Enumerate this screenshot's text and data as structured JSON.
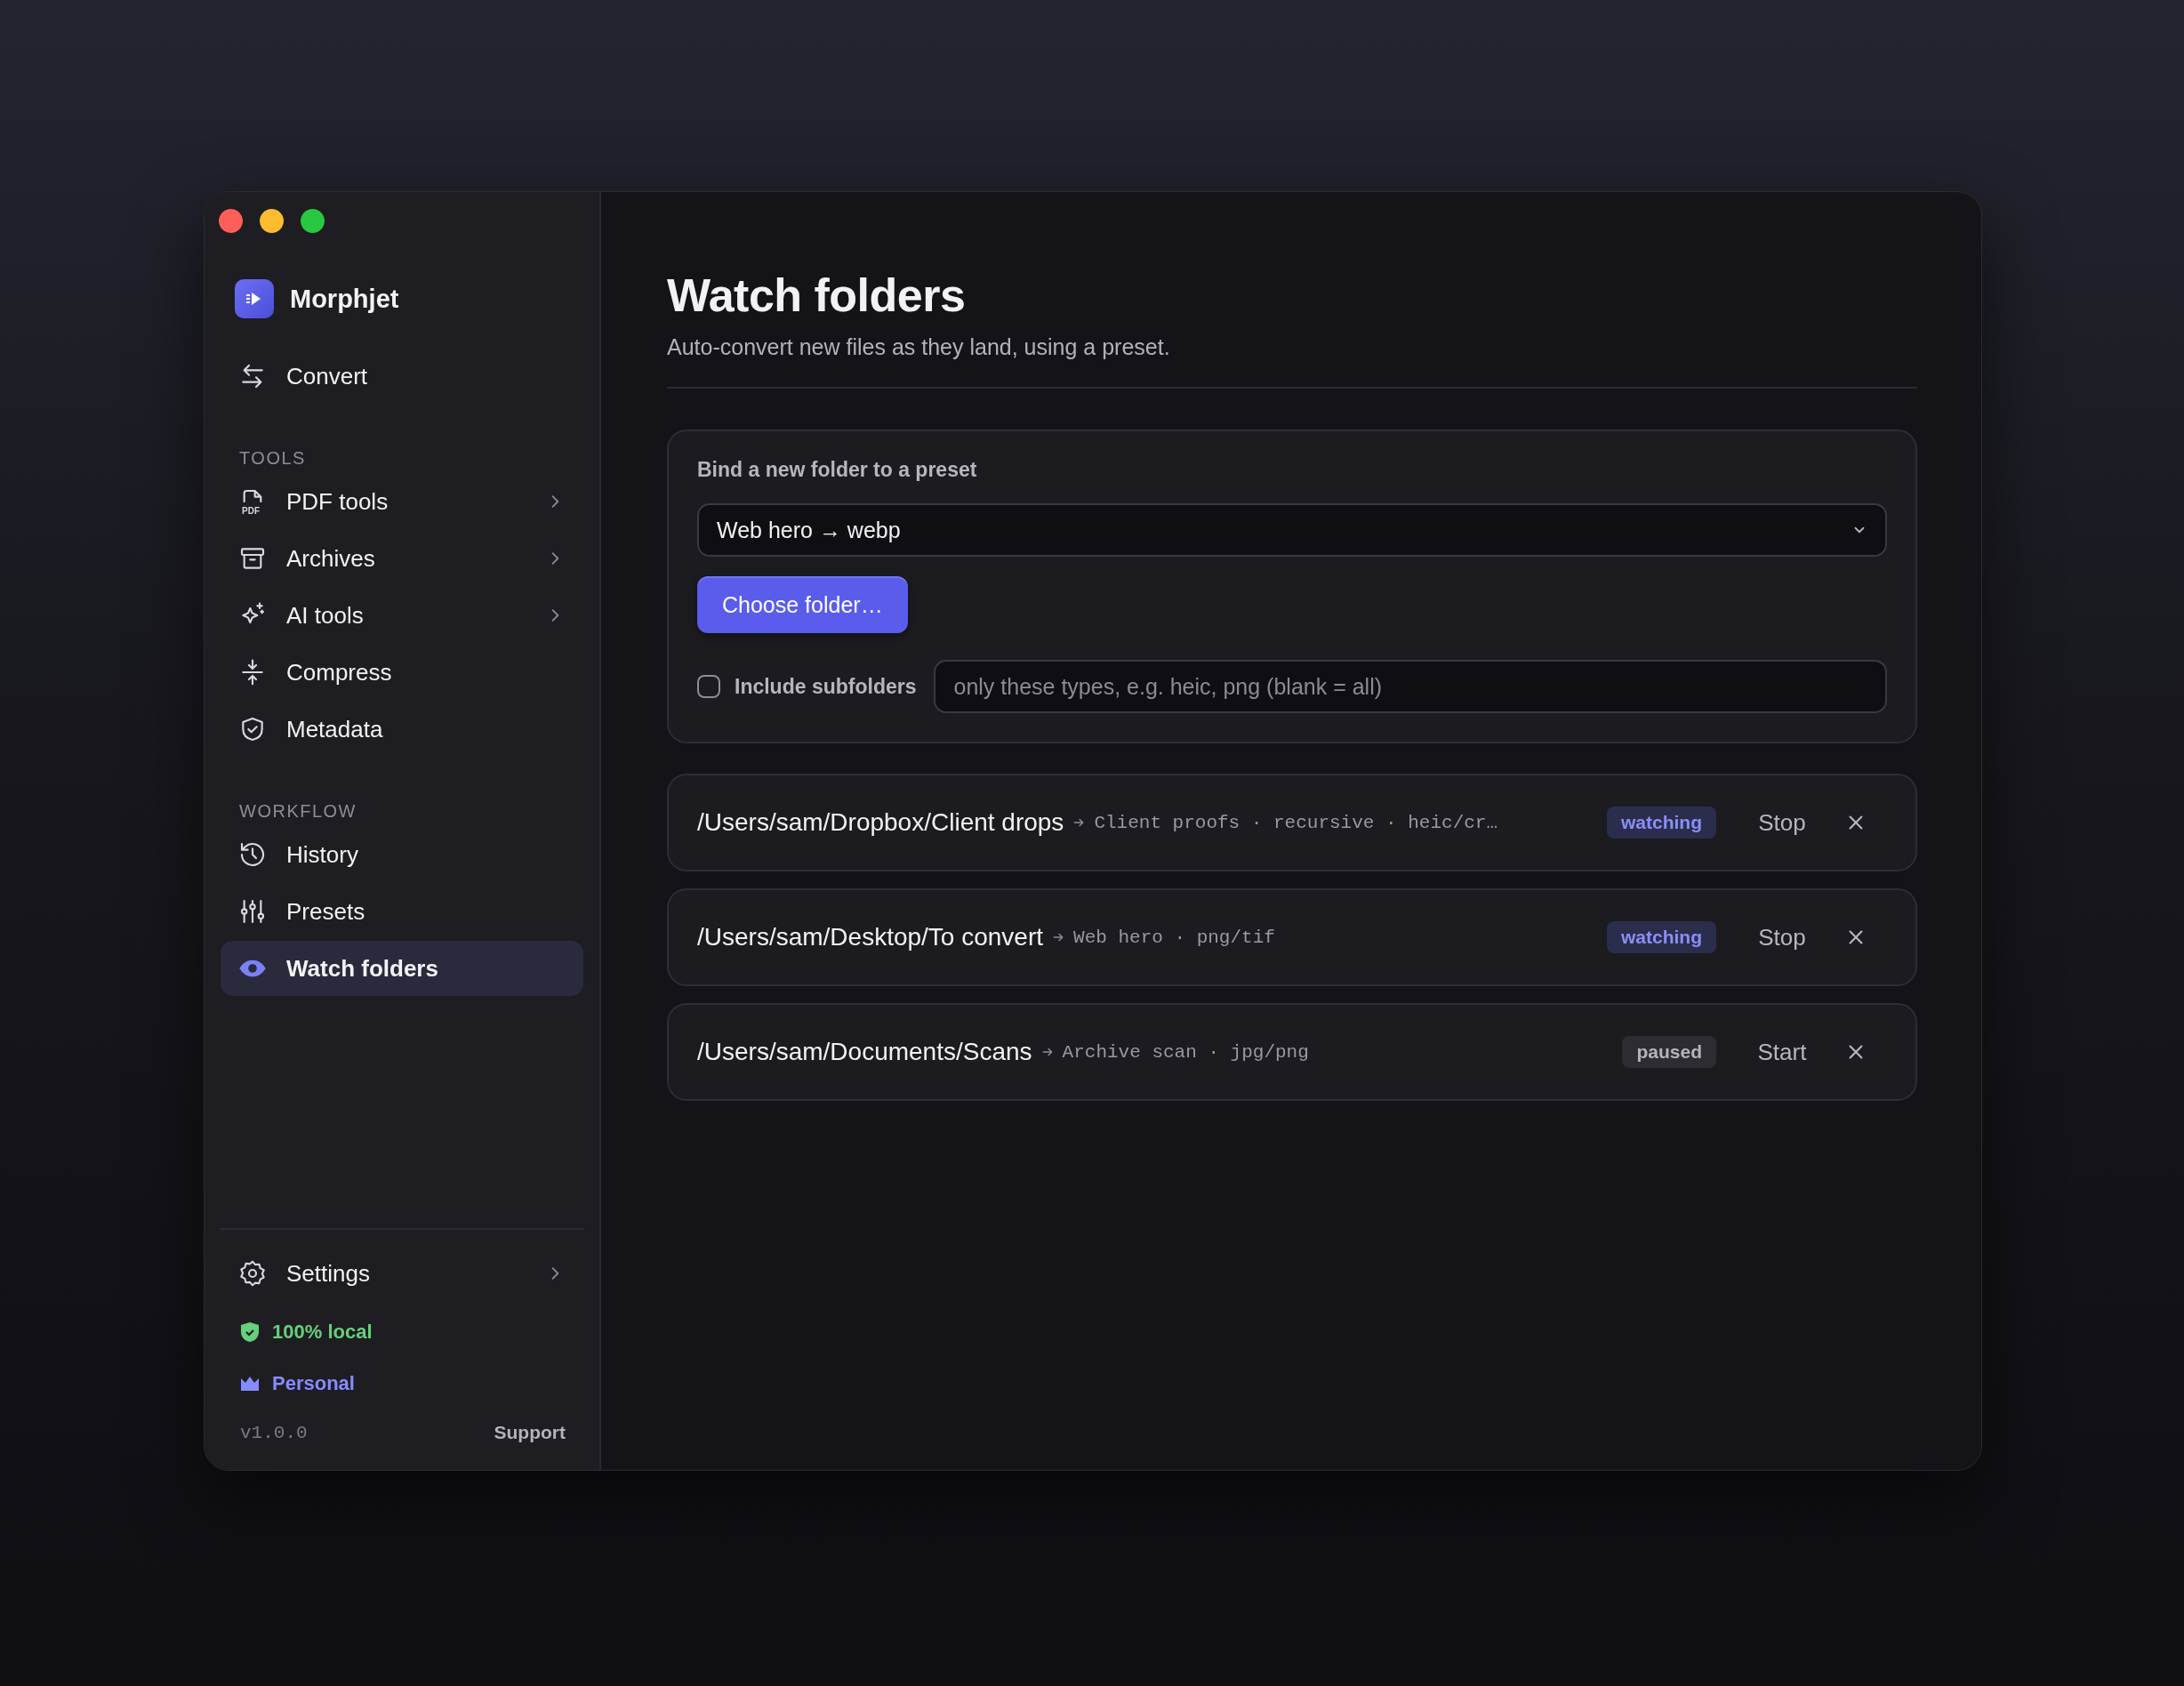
{
  "sidebar": {
    "app_name": "Morphjet",
    "top_items": [
      {
        "label": "Convert",
        "has_submenu": false,
        "selected": false
      }
    ],
    "sections": [
      {
        "title": "TOOLS",
        "items": [
          {
            "label": "PDF tools",
            "icon_text": "PDF",
            "has_submenu": true,
            "selected": false
          },
          {
            "label": "Archives",
            "has_submenu": true,
            "selected": false
          },
          {
            "label": "AI tools",
            "has_submenu": true,
            "selected": false
          },
          {
            "label": "Compress",
            "has_submenu": false,
            "selected": false
          },
          {
            "label": "Metadata",
            "has_submenu": false,
            "selected": false
          }
        ]
      },
      {
        "title": "WORKFLOW",
        "items": [
          {
            "label": "History",
            "has_submenu": false,
            "selected": false
          },
          {
            "label": "Presets",
            "has_submenu": false,
            "selected": false
          },
          {
            "label": "Watch folders",
            "has_submenu": false,
            "selected": true
          }
        ]
      }
    ],
    "settings": {
      "label": "Settings",
      "has_submenu": true
    },
    "local_badge": "100% local",
    "plan": "Personal",
    "version": "v1.0.0",
    "support_link": "Support"
  },
  "main": {
    "title": "Watch folders",
    "subtitle": "Auto-convert new files as they land, using a preset.",
    "bind_card": {
      "label": "Bind a new folder to a preset",
      "preset_select": {
        "value": "Web hero → webp"
      },
      "choose_button": "Choose folder…",
      "include_subfolders": {
        "label": "Include subfolders",
        "checked": false
      },
      "types_field": {
        "placeholder": "only these types, e.g. heic, png (blank = all)"
      }
    },
    "folders": [
      {
        "path": "/Users/sam/Dropbox/Client drops",
        "details": "Client proofs · recursive · heic/cr…",
        "status": "watching",
        "action": "Stop"
      },
      {
        "path": "/Users/sam/Desktop/To convert",
        "details": "Web hero · png/tif",
        "status": "watching",
        "action": "Stop"
      },
      {
        "path": "/Users/sam/Documents/Scans",
        "details": "Archive scan · jpg/png",
        "status": "paused",
        "action": "Start"
      }
    ]
  }
}
